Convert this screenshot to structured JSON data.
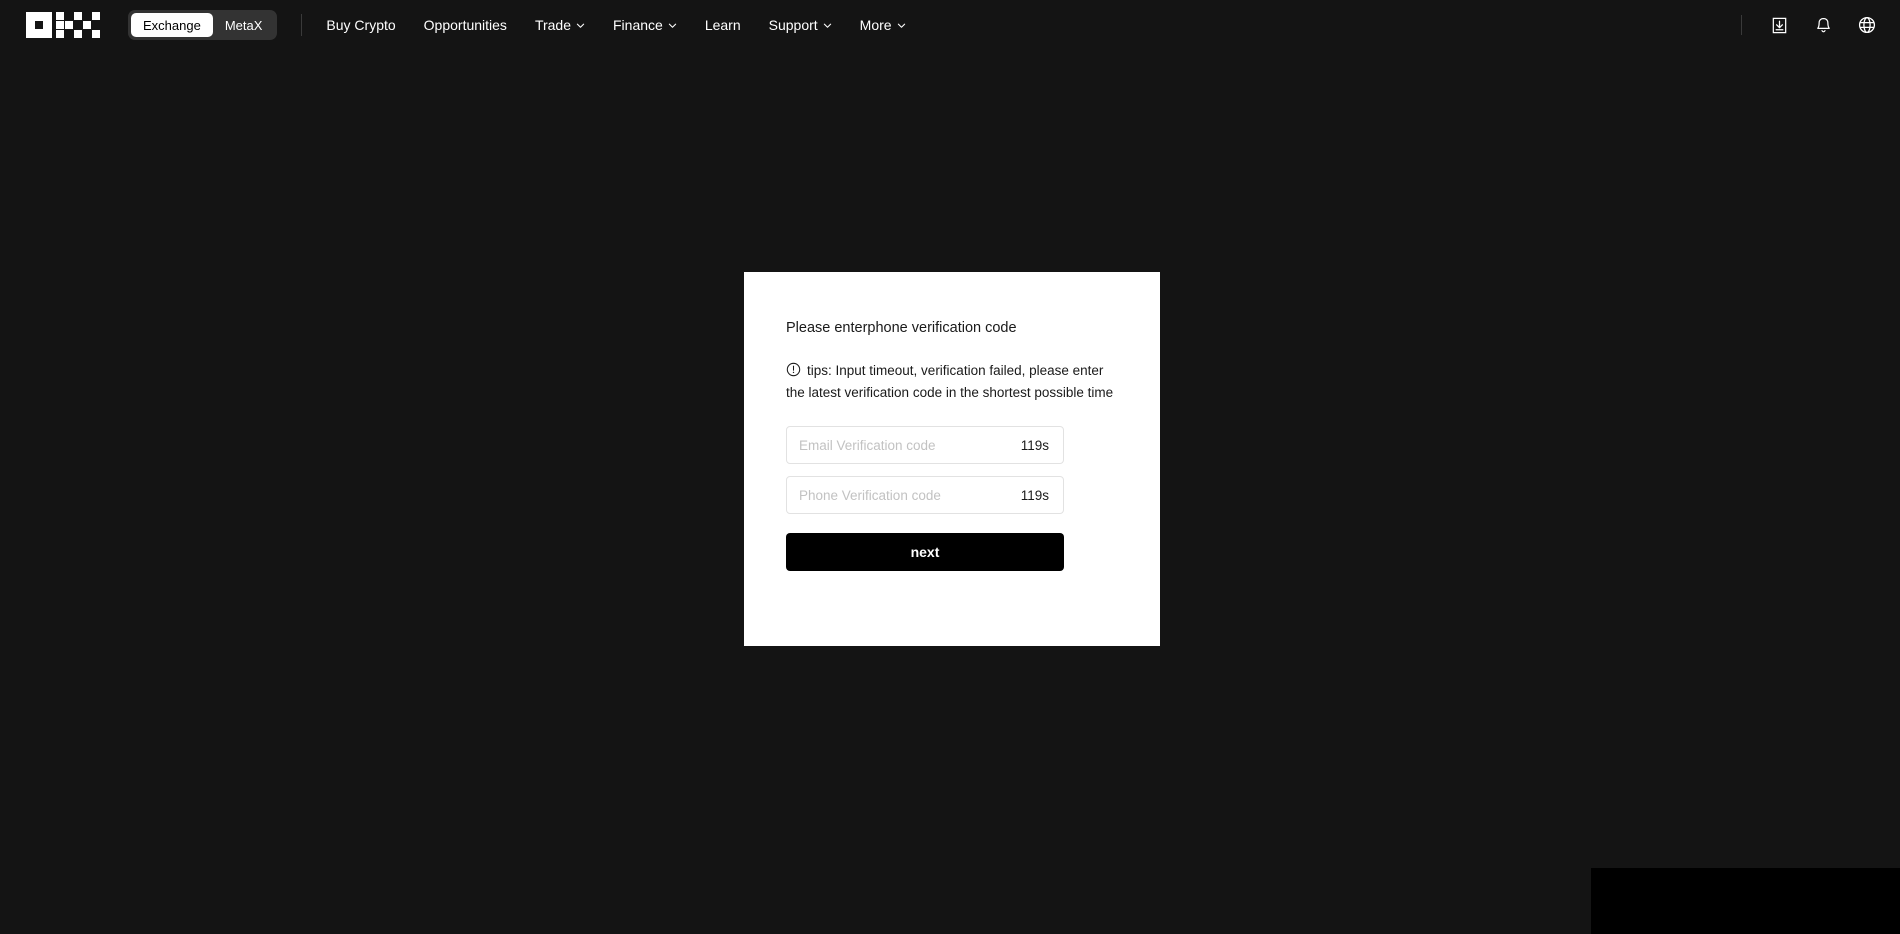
{
  "header": {
    "logo_name": "okx-logo",
    "toggle": {
      "options": [
        {
          "label": "Exchange",
          "active": true
        },
        {
          "label": "MetaX",
          "active": false
        }
      ]
    },
    "nav": [
      {
        "label": "Buy Crypto",
        "has_caret": false
      },
      {
        "label": "Opportunities",
        "has_caret": false
      },
      {
        "label": "Trade",
        "has_caret": true
      },
      {
        "label": "Finance",
        "has_caret": true
      },
      {
        "label": "Learn",
        "has_caret": false
      },
      {
        "label": "Support",
        "has_caret": true
      },
      {
        "label": "More",
        "has_caret": true
      }
    ],
    "actions": [
      {
        "icon": "download-icon"
      },
      {
        "icon": "bell-icon"
      },
      {
        "icon": "globe-icon"
      }
    ]
  },
  "modal": {
    "title": "Please enterphone verification code",
    "tips_icon": "exclamation-circle-icon",
    "tips": "tips: Input timeout, verification failed, please enter the latest verification code in the shortest possible time",
    "fields": [
      {
        "name": "email-verification-code",
        "placeholder": "Email Verification code",
        "value": "",
        "timer": "119s"
      },
      {
        "name": "phone-verification-code",
        "placeholder": "Phone Verification code",
        "value": "",
        "timer": "119s"
      }
    ],
    "submit_label": "next"
  },
  "colors": {
    "page_background": "#141414",
    "card_background": "#ffffff",
    "accent": "#000000",
    "text_light": "#ffffff",
    "text_dark": "#1a1a1a",
    "placeholder": "#c2c2c2",
    "field_border": "#e2e2e2"
  }
}
